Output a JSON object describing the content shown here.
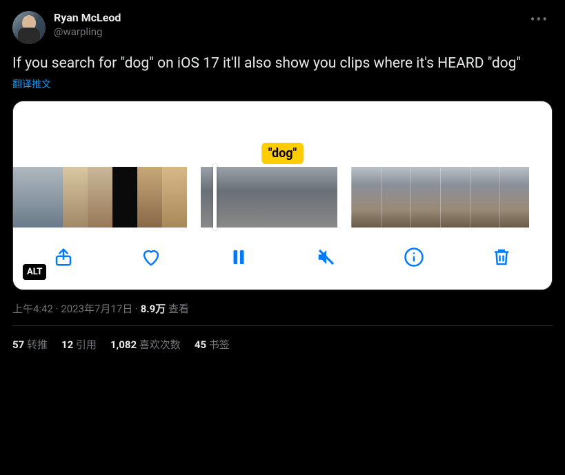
{
  "user": {
    "display_name": "Ryan McLeod",
    "handle": "@warpling"
  },
  "tweet_text": "If you search for \"dog\" on iOS 17 it'll also show you clips where it's HEARD \"dog\"",
  "translate_label": "翻译推文",
  "media": {
    "highlight_label": "\"dog\"",
    "alt_badge": "ALT",
    "toolbar": {
      "share": "share",
      "like": "like",
      "pause": "pause",
      "mute": "mute",
      "info": "info",
      "trash": "trash"
    }
  },
  "meta": {
    "time": "上午4:42",
    "date": "2023年7月17日",
    "views_count": "8.9万",
    "views_label": "查看"
  },
  "stats": {
    "retweets_count": "57",
    "retweets_label": "转推",
    "quotes_count": "12",
    "quotes_label": "引用",
    "likes_count": "1,082",
    "likes_label": "喜欢次数",
    "bookmarks_count": "45",
    "bookmarks_label": "书签"
  }
}
